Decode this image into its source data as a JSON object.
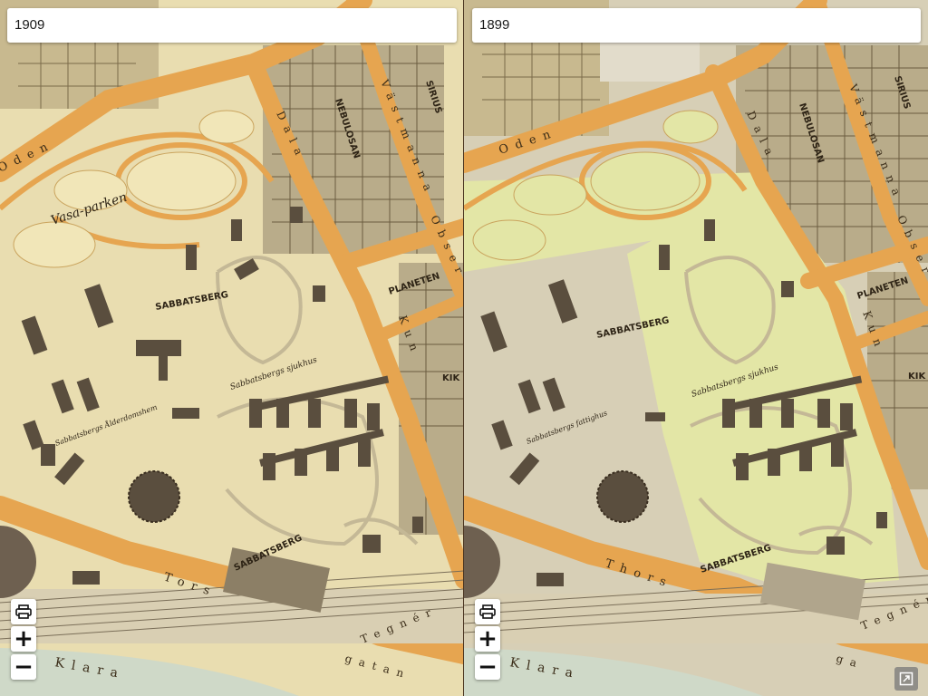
{
  "left_panel": {
    "year": "1909",
    "map_labels": {
      "park": "Vasa-parken",
      "district_main": "SABBATSBERG",
      "district_south": "SABBATSBERG",
      "hospital": "Sabbatsbergs sjukhus",
      "elder_home": "Sabbatsbergs Ålderdomshem",
      "block_nebulosan": "NEBULOSAN",
      "block_sirius": "SIRIUS",
      "block_planeten": "PLANETEN",
      "block_kik": "KIK",
      "street_oden": "Oden",
      "street_dala": "Dala",
      "street_obser": "Obser",
      "street_kungs": "Kun",
      "street_vastmanna": "Västmanna",
      "street_tors": "Tors",
      "street_tegner": "Tegnér",
      "street_klara": "Klara",
      "street_gatan": "gatan"
    }
  },
  "right_panel": {
    "year": "1899",
    "map_labels": {
      "district_main": "SABBATSBERG",
      "district_south": "SABBATSBERG",
      "hospital": "Sabbatsbergs sjukhus",
      "fattighus": "Sabbatsbergs fattighus",
      "block_nebulosan": "NEBULOSAN",
      "block_sirius": "SIRIUS",
      "block_planeten": "PLANETEN",
      "block_kik": "KIK",
      "street_oden": "Oden",
      "street_dala": "Dala",
      "street_obser": "Obser",
      "street_kungs": "Kun",
      "street_vastmanna": "Västmanna",
      "street_thors": "Thors",
      "street_tegner": "Tegnér",
      "street_klara": "Klara",
      "street_gatan": "ga"
    }
  },
  "controls": {
    "print_icon": "print-icon",
    "zoom_in_label": "+",
    "zoom_out_label": "−",
    "fullscreen_icon": "fullscreen-icon"
  },
  "colors": {
    "map_parchment": "#e8dcae",
    "street_orange": "#e6a550",
    "park_yellow_1899": "#e3e6a6",
    "building_dark": "#5a4e3e",
    "block_gray": "#b9ac8a"
  }
}
